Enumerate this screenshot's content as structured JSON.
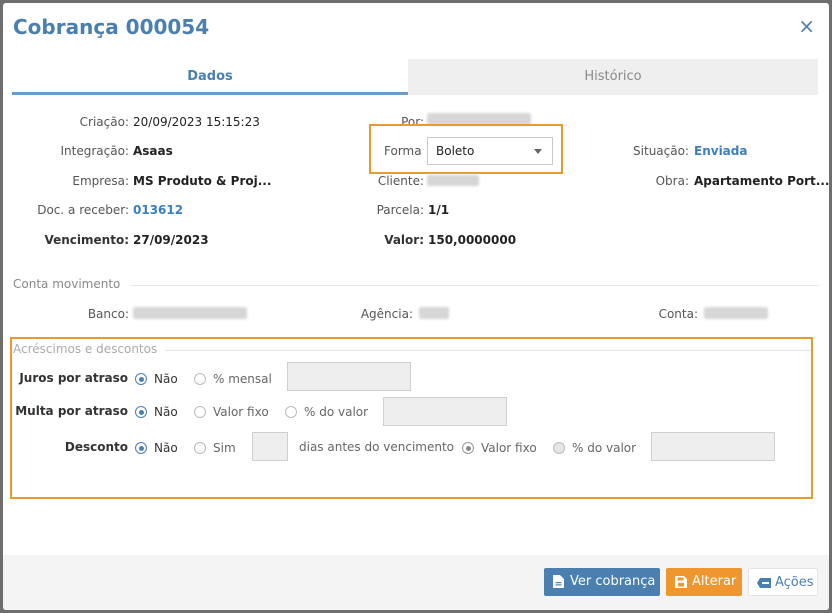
{
  "modal": {
    "title": "Cobrança 000054",
    "close": "×"
  },
  "tabs": [
    {
      "label": "Dados"
    },
    {
      "label": "Histórico"
    }
  ],
  "dados": {
    "criacao_label": "Criação:",
    "criacao_value": "20/09/2023 15:15:23",
    "por_label": "Por:",
    "integracao_label": "Integração:",
    "integracao_value": "Asaas",
    "forma_label": "Forma",
    "forma_value": "Boleto",
    "situacao_label": "Situação:",
    "situacao_value": "Enviada",
    "empresa_label": "Empresa:",
    "empresa_value": "MS Produto & Proj...",
    "cliente_label": "Cliente:",
    "obra_label": "Obra:",
    "obra_value": "Apartamento Port...",
    "doc_label": "Doc. a receber:",
    "doc_value": "013612",
    "parcela_label": "Parcela:",
    "parcela_value": "1/1",
    "vencimento_label": "Vencimento:",
    "vencimento_value": "27/09/2023",
    "valor_label": "Valor:",
    "valor_value": "150,0000000"
  },
  "conta": {
    "section": "Conta movimento",
    "banco_label": "Banco:",
    "agencia_label": "Agência:",
    "conta_label": "Conta:"
  },
  "acrescimos": {
    "section": "Acréscimos e descontos",
    "juros_label": "Juros por atraso",
    "juros_nao": "Não",
    "juros_mensal": "% mensal",
    "multa_label": "Multa por atraso",
    "multa_nao": "Não",
    "multa_fixo": "Valor fixo",
    "multa_pct": "% do valor",
    "desconto_label": "Desconto",
    "desconto_nao": "Não",
    "desconto_sim": "Sim",
    "dias_label": "dias antes do vencimento",
    "desc_fixo": "Valor fixo",
    "desc_pct": "% do valor"
  },
  "footer": {
    "ver_label": "Ver cobrança",
    "alterar_label": "Alterar",
    "acoes_label": "Ações"
  },
  "colors": {
    "accent": "#4a7fb0",
    "highlight": "#e89a2e",
    "alterar": "#f0962e"
  }
}
